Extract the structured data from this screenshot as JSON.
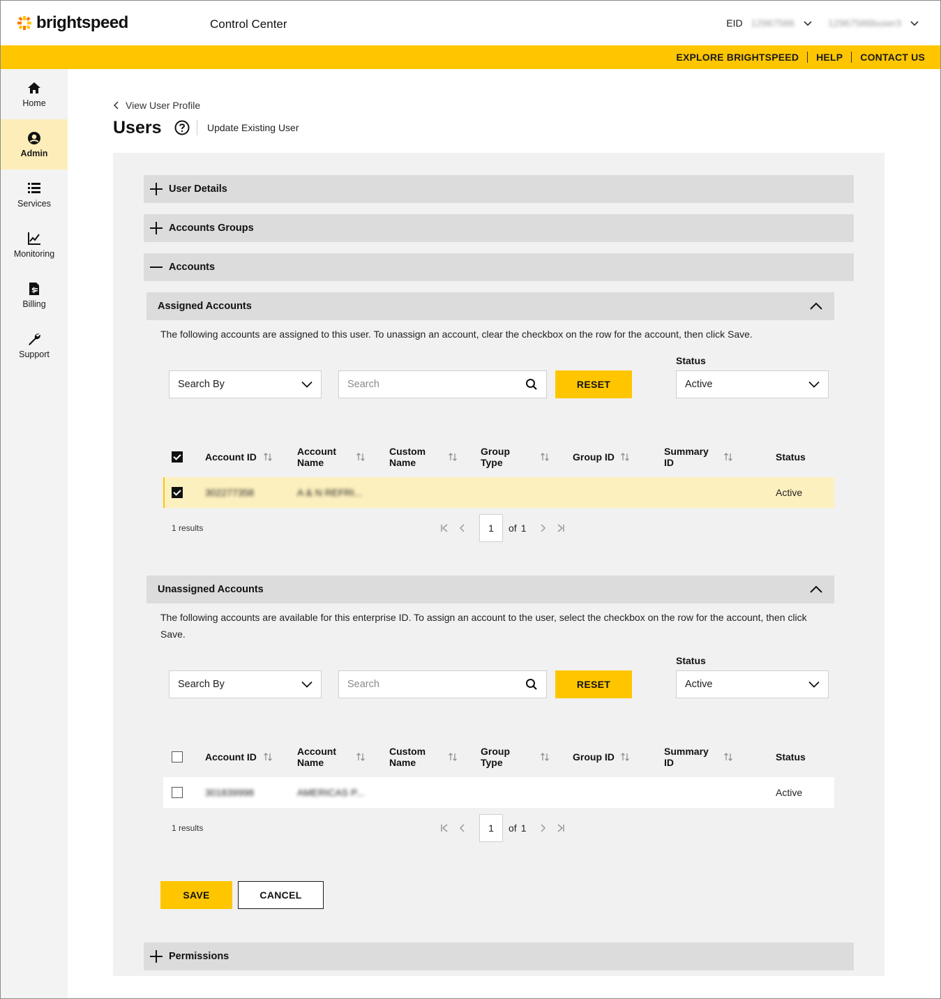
{
  "brand": {
    "name": "brightspeed",
    "accent": "#ffc600",
    "accent_light": "#fdf0bf"
  },
  "header": {
    "app_title": "Control Center",
    "eid_label": "EID",
    "eid_value": "12967586",
    "user_value": "12967586buser3"
  },
  "top_links": [
    "EXPLORE BRIGHTSPEED",
    "HELP",
    "CONTACT US"
  ],
  "sidebar": {
    "items": [
      {
        "label": "Home",
        "icon": "home-icon"
      },
      {
        "label": "Admin",
        "icon": "user-circle-icon",
        "active": true
      },
      {
        "label": "Services",
        "icon": "list-icon"
      },
      {
        "label": "Monitoring",
        "icon": "chart-line-icon"
      },
      {
        "label": "Billing",
        "icon": "invoice-icon"
      },
      {
        "label": "Support",
        "icon": "wrench-icon"
      }
    ]
  },
  "page": {
    "back_link": "View User Profile",
    "title": "Users",
    "subtitle": "Update Existing User"
  },
  "sections": {
    "user_details": "User Details",
    "accounts_groups": "Accounts Groups",
    "accounts": "Accounts",
    "permissions": "Permissions"
  },
  "assigned": {
    "title": "Assigned Accounts",
    "description": "The following accounts are assigned to this user. To unassign an account, clear the checkbox on the row for the account, then click Save.",
    "search_by": "Search By",
    "search_placeholder": "Search",
    "reset": "RESET",
    "status_label": "Status",
    "status_value": "Active",
    "columns": [
      "Account ID",
      "Account Name",
      "Custom Name",
      "Group Type",
      "Group ID",
      "Summary ID",
      "Status"
    ],
    "rows": [
      {
        "checked": true,
        "account_id": "302277358",
        "account_name": "A & N REFRI...",
        "custom_name": "",
        "group_type": "",
        "group_id": "",
        "summary_id": "",
        "status": "Active"
      }
    ],
    "results": "1 results",
    "page": "1",
    "of": "of",
    "total_pages": "1"
  },
  "unassigned": {
    "title": "Unassigned Accounts",
    "description": "The following accounts are available for this enterprise ID. To assign an account to the user, select the checkbox on the row for the account, then click Save.",
    "search_by": "Search By",
    "search_placeholder": "Search",
    "reset": "RESET",
    "status_label": "Status",
    "status_value": "Active",
    "columns": [
      "Account ID",
      "Account Name",
      "Custom Name",
      "Group Type",
      "Group ID",
      "Summary ID",
      "Status"
    ],
    "rows": [
      {
        "checked": false,
        "account_id": "301839998",
        "account_name": "AMERICAS P...",
        "custom_name": "",
        "group_type": "",
        "group_id": "",
        "summary_id": "",
        "status": "Active"
      }
    ],
    "results": "1 results",
    "page": "1",
    "of": "of",
    "total_pages": "1"
  },
  "actions": {
    "save": "SAVE",
    "cancel": "CANCEL"
  }
}
